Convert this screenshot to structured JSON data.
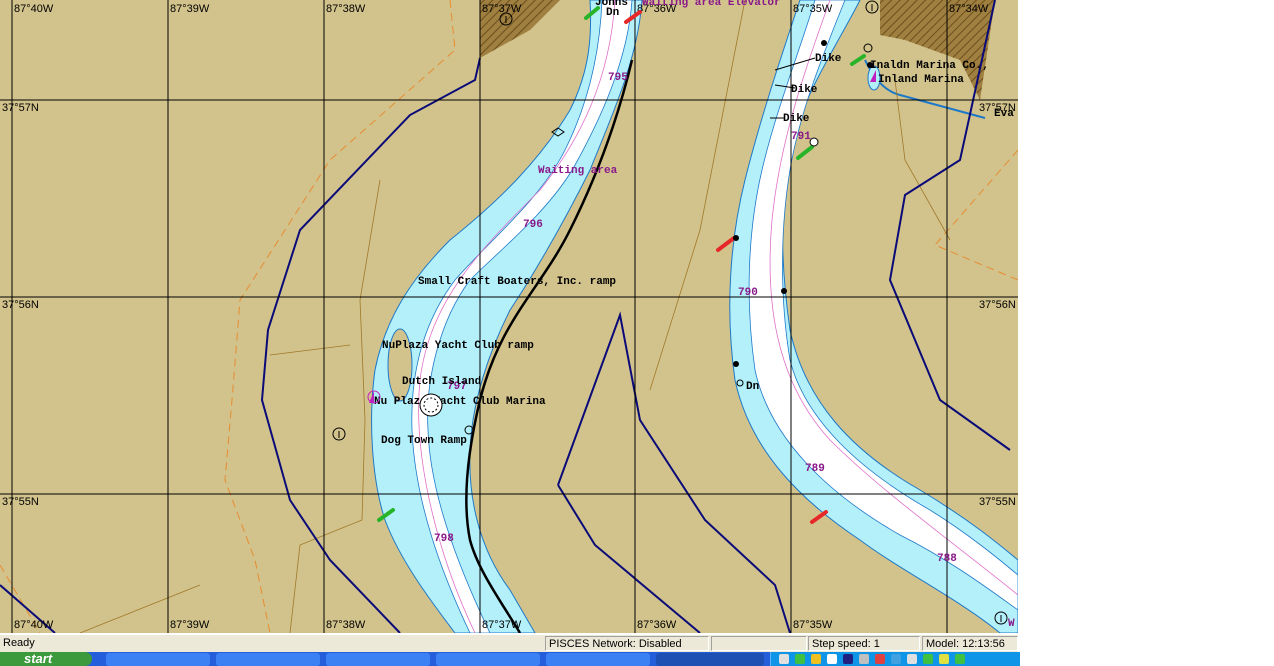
{
  "map": {
    "lon_labels": [
      "87°40W",
      "87°39W",
      "87°38W",
      "87°37W",
      "87°36W",
      "87°35W",
      "87°34W"
    ],
    "lat_labels": [
      "37°57N",
      "37°56N",
      "37°55N"
    ],
    "river_miles": [
      "795",
      "796",
      "797",
      "798",
      "791",
      "790",
      "789",
      "788"
    ],
    "features": {
      "waiting_area": "Waiting area",
      "elevator": "Waiting area Elevator",
      "small_craft": "Small Craft Boaters, Inc. ramp",
      "nuplaza_ramp": "NuPlaza Yacht Club ramp",
      "dutch_island": "Dutch Island",
      "nuplaza_marina": "Nu Plaza Yacht Club Marina",
      "dog_town": "Dog Town Ramp",
      "dike1": "Dike",
      "dike2": "Dike",
      "dike3": "Dike",
      "marina_co": "Inaldn Marina Co.,",
      "inland_marina": "Inland Marina",
      "eva": "Eva",
      "dn_top": "Dn",
      "dn_right": "Dn",
      "johns": "Johns",
      "w_edge": "W"
    },
    "colors": {
      "land": "#d2c38c",
      "water_shallow": "#b4f0fa",
      "water_channel": "#ffffff",
      "grid": "#000000",
      "boundary": "#0a0a78",
      "dashed": "#e68c32",
      "label": "#8a1a8a",
      "red_buoy": "#e62828",
      "green_buoy": "#28b428"
    }
  },
  "statusbar": {
    "ready": "Ready",
    "network": "PISCES Network: Disabled",
    "step_speed": "Step speed: 1",
    "model_time": "Model: 12:13:56"
  },
  "taskbar": {
    "start_label": "start"
  }
}
